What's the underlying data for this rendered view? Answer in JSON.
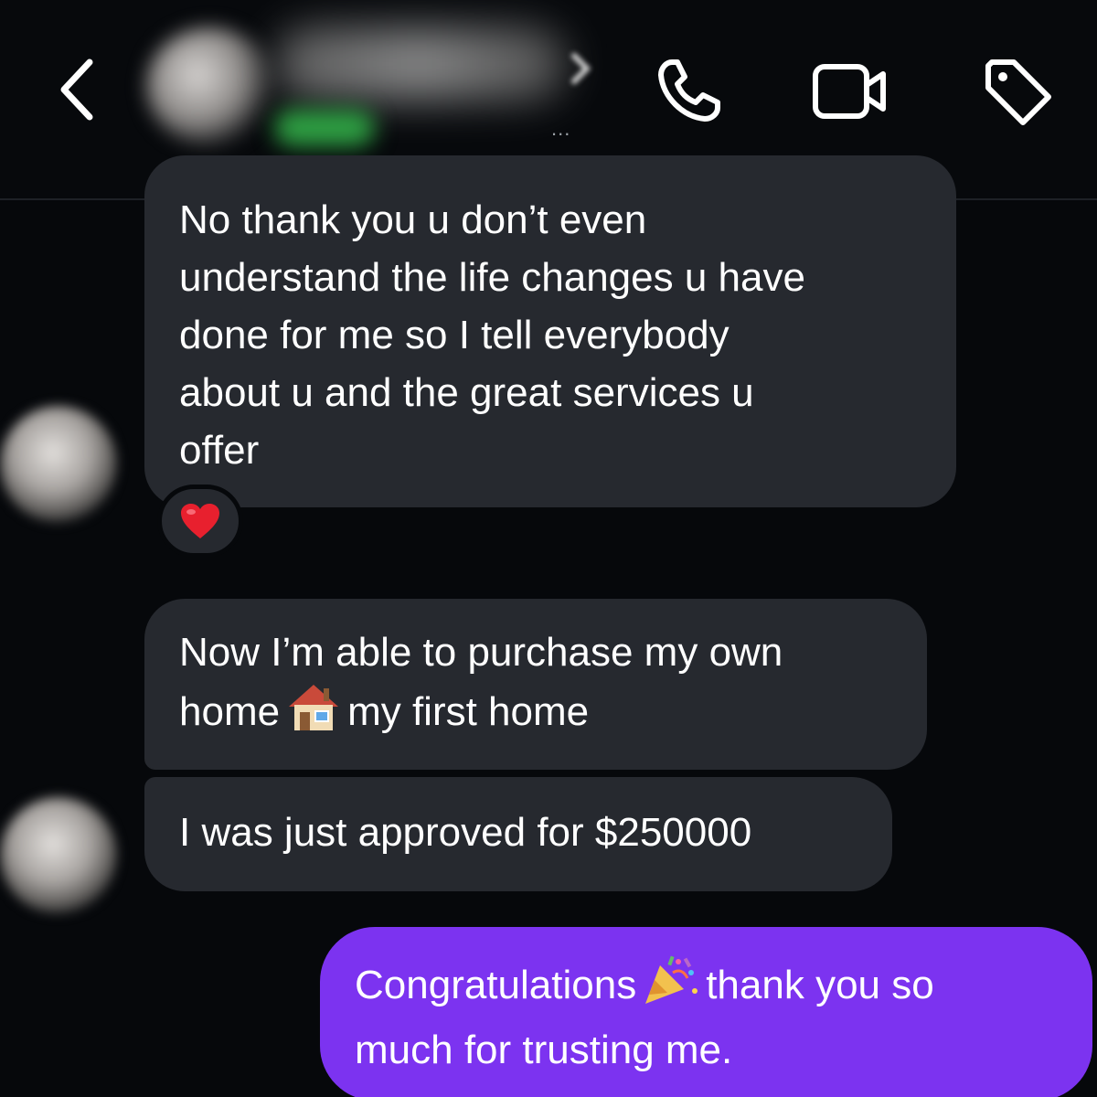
{
  "header": {
    "back_icon": "chevron-left-icon",
    "contact_name": "",
    "contact_status": "...",
    "actions": [
      {
        "name": "phone-icon"
      },
      {
        "name": "video-camera-icon"
      },
      {
        "name": "tag-icon"
      }
    ]
  },
  "messages": [
    {
      "sender": "them",
      "text": "No thank you u don’t even\nunderstand the life changes u have\ndone for me so I tell everybody\nabout u and the great services u\noffer",
      "reaction": "heart"
    },
    {
      "sender": "them",
      "text_before": "Now I’m able to purchase my own\nhome",
      "emoji": "house-emoji",
      "text_after": "my first home"
    },
    {
      "sender": "them",
      "text": "I was just approved for $250000"
    },
    {
      "sender": "me",
      "text_before": "Congratulations",
      "emoji": "party-popper-emoji",
      "text_after": "thank you so\nmuch for trusting me."
    }
  ],
  "colors": {
    "background": "#06080b",
    "incoming_bubble": "#26292f",
    "outgoing_bubble": "#7c33f0",
    "reaction_heart": "#e8202e"
  }
}
